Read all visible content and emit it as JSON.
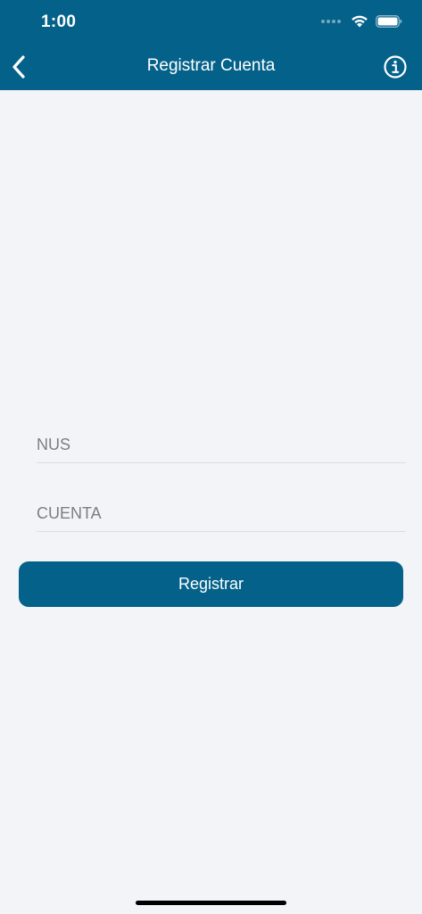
{
  "status_bar": {
    "time": "1:00"
  },
  "nav": {
    "title": "Registrar Cuenta",
    "back_icon": "chevron-left-icon",
    "info_icon": "info-circle-icon"
  },
  "form": {
    "nus_placeholder": "NUS",
    "nus_value": "",
    "cuenta_placeholder": "CUENTA",
    "cuenta_value": "",
    "submit_label": "Registrar"
  },
  "colors": {
    "primary": "#04628a",
    "background": "#f3f4f7"
  }
}
